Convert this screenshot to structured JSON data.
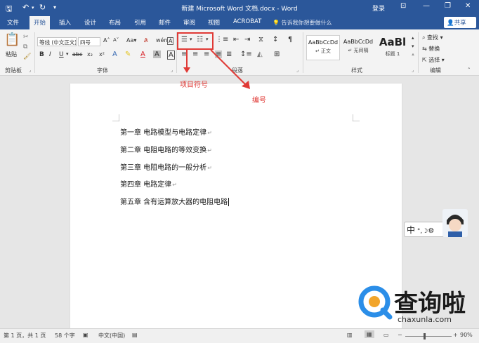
{
  "titlebar": {
    "doc_title": "新建 Microsoft Word 文档.docx  -  Word",
    "login": "登录"
  },
  "tabs": [
    "文件",
    "开始",
    "插入",
    "设计",
    "布局",
    "引用",
    "邮件",
    "审阅",
    "视图",
    "ACROBAT"
  ],
  "tell_me": "告诉我你想要做什么",
  "share": "共享",
  "ribbon": {
    "paste_label": "粘贴",
    "font_name": "等线 (中文正文)",
    "font_size": "四号",
    "groups": {
      "clipboard": "剪贴板",
      "font": "字体",
      "paragraph": "段落",
      "styles": "样式",
      "editing": "编辑"
    },
    "styles": [
      {
        "sample": "AaBbCcDd",
        "name": "↵ 正文"
      },
      {
        "sample": "AaBbCcDd",
        "name": "↵ 无间隔"
      },
      {
        "sample": "AaBl",
        "name": "标题 1"
      }
    ],
    "editing": {
      "find": "查找",
      "replace": "替换",
      "select": "选择"
    }
  },
  "annotations": {
    "bullets": "项目符号",
    "numbering": "编号"
  },
  "document_lines": [
    "第一章  电路模型与电路定律",
    "第二章  电阻电路的等效变换",
    "第三章  电阻电路的一般分析",
    "第四章  电路定律",
    "第五章  含有运算放大器的电阻电路"
  ],
  "ime": {
    "label": "中"
  },
  "watermark": {
    "text": "查询啦",
    "url": "chaxunla.com"
  },
  "status": {
    "page": "第 1 页，共 1 页",
    "words": "58 个字",
    "language": "中文(中国)",
    "zoom": "90%"
  },
  "colors": {
    "accent": "#2b579a",
    "annotation": "#e03a36"
  }
}
